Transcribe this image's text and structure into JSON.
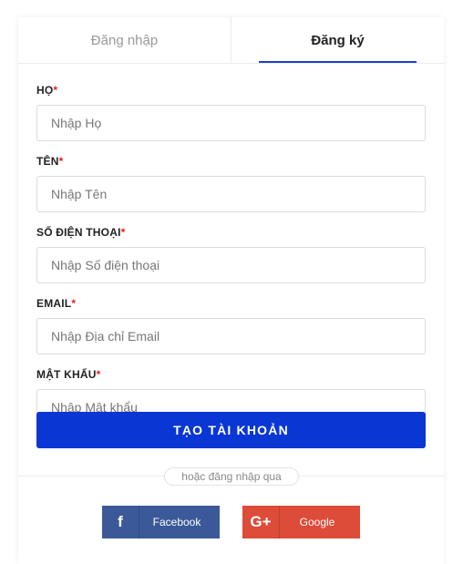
{
  "tabs": [
    {
      "label": "Đăng nhập",
      "active": false
    },
    {
      "label": "Đăng ký",
      "active": true
    }
  ],
  "form": {
    "fields": [
      {
        "label": "HỌ",
        "required": "*",
        "placeholder": "Nhập Họ",
        "value": ""
      },
      {
        "label": "TÊN",
        "required": "*",
        "placeholder": "Nhập Tên",
        "value": ""
      },
      {
        "label": "SỐ ĐIỆN THOẠI",
        "required": "*",
        "placeholder": "Nhập Số điện thoại",
        "value": ""
      },
      {
        "label": "EMAIL",
        "required": "*",
        "placeholder": "Nhập Địa chỉ Email",
        "value": ""
      },
      {
        "label": "MẬT KHẨU",
        "required": "*",
        "placeholder": "Nhập Mật khẩu",
        "value": ""
      }
    ],
    "submit_label": "TẠO TÀI KHOẢN"
  },
  "social": {
    "divider_text": "hoặc đăng nhập qua",
    "facebook": {
      "icon": "facebook-icon",
      "glyph": "f",
      "label": "Facebook",
      "color": "#3b5998"
    },
    "google": {
      "icon": "google-plus-icon",
      "glyph": "G+",
      "label": "Google",
      "color": "#dd4b39"
    }
  },
  "colors": {
    "accent": "#0a36d4",
    "tab_underline": "#1a3fd6",
    "required": "#e02020"
  }
}
